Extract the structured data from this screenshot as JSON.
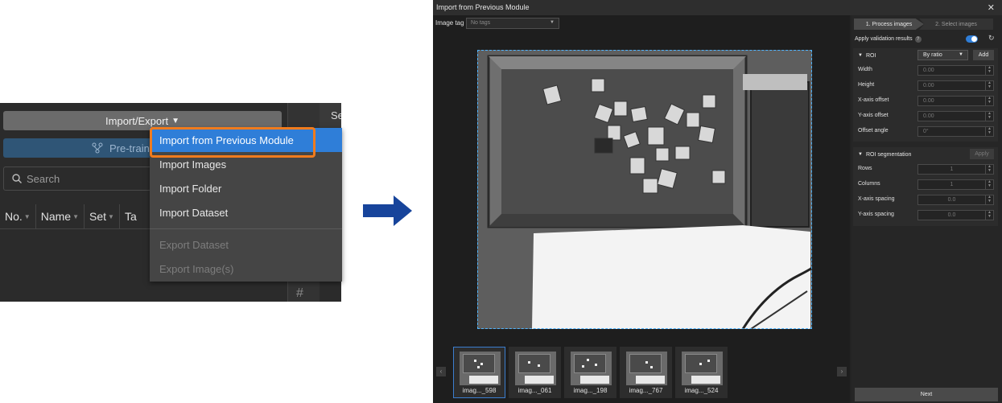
{
  "left_panel": {
    "import_export_label": "Import/Export",
    "se_tab_label": "Se",
    "pretrain_label": "Pre-train",
    "search_placeholder": "Search",
    "columns": [
      "No.",
      "Name",
      "Set",
      "Ta"
    ],
    "menu": {
      "items": [
        {
          "label": "Import from Previous Module",
          "enabled": true,
          "highlighted": true
        },
        {
          "label": "Import Images",
          "enabled": true
        },
        {
          "label": "Import Folder",
          "enabled": true
        },
        {
          "label": "Import Dataset",
          "enabled": true
        },
        {
          "label": "Export Dataset",
          "enabled": false
        },
        {
          "label": "Export Image(s)",
          "enabled": false
        }
      ]
    }
  },
  "arrow_color": "#17449b",
  "dialog": {
    "title": "Import from Previous Module",
    "close_icon": "close-icon",
    "image_tag_label": "Image tag",
    "image_tag_placeholder": "No tags",
    "thumbnails": [
      {
        "label": "imag..._598",
        "selected": true
      },
      {
        "label": "imag..._061",
        "selected": false
      },
      {
        "label": "imag..._198",
        "selected": false
      },
      {
        "label": "imag..._767",
        "selected": false
      },
      {
        "label": "imag..._524",
        "selected": false
      }
    ],
    "steps": [
      "1. Process images",
      "2. Select images"
    ],
    "apply_validation_label": "Apply validation results",
    "apply_validation_on": true,
    "roi": {
      "title": "ROI",
      "mode": "By ratio",
      "add_label": "Add",
      "fields": [
        {
          "label": "Width",
          "value": "0.00"
        },
        {
          "label": "Height",
          "value": "0.00"
        },
        {
          "label": "X-axis offset",
          "value": "0.00"
        },
        {
          "label": "Y-axis offset",
          "value": "0.00"
        },
        {
          "label": "Offset angle",
          "value": "0°"
        }
      ]
    },
    "roi_segmentation": {
      "title": "ROI segmentation",
      "apply_label": "Apply",
      "fields": [
        {
          "label": "Rows",
          "value": "1"
        },
        {
          "label": "Columns",
          "value": "1"
        },
        {
          "label": "X-axis spacing",
          "value": "0.0"
        },
        {
          "label": "Y-axis spacing",
          "value": "0.0"
        }
      ]
    },
    "next_label": "Next"
  },
  "colors": {
    "accent": "#2f7ed8",
    "highlight_border": "#f07b1d",
    "roi_dashed": "#4fb4ff"
  }
}
